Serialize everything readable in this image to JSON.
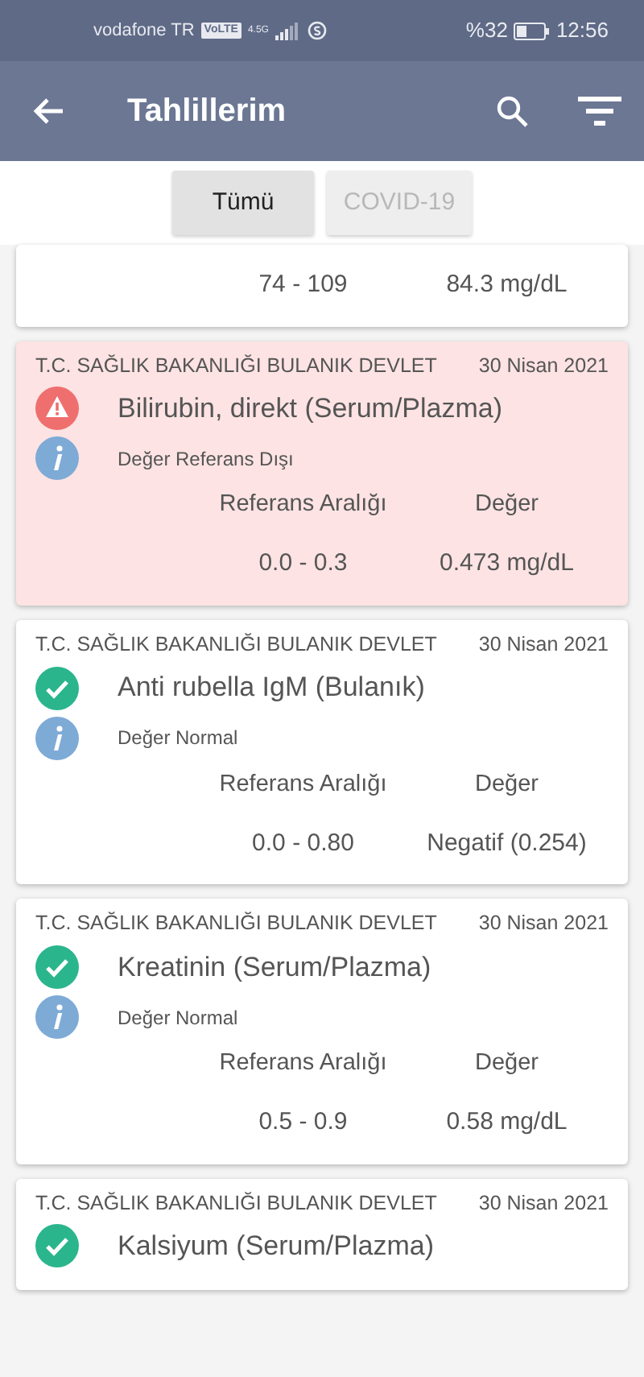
{
  "status_bar": {
    "carrier": "vodafone TR",
    "volte": "VoLTE",
    "network": "4.5G",
    "battery": "%32",
    "time": "12:56"
  },
  "app_bar": {
    "title": "Tahlillerim"
  },
  "tabs": [
    {
      "label": "Tümü",
      "selected": true
    },
    {
      "label": "COVID-19",
      "selected": false
    }
  ],
  "partial_card": {
    "range": "74 - 109",
    "value": "84.3 mg/dL"
  },
  "results": [
    {
      "hospital": "T.C. SAĞLIK BAKANLIĞI BULANIK DEVLET",
      "date": "30 Nisan 2021",
      "test": "Bilirubin, direkt (Serum/Plazma)",
      "kind": "abnormal",
      "status_text": "Değer Referans Dışı",
      "range_heading": "Referans Aralığı",
      "value_heading": "Değer",
      "range": "0.0 - 0.3",
      "value": "0.473 mg/dL"
    },
    {
      "hospital": "T.C. SAĞLIK BAKANLIĞI BULANIK DEVLET",
      "date": "30 Nisan 2021",
      "test": "Anti rubella IgM (Bulanık)",
      "kind": "normal",
      "status_text": "Değer Normal",
      "range_heading": "Referans Aralığı",
      "value_heading": "Değer",
      "range": "0.0 - 0.80",
      "value": "Negatif (0.254)"
    },
    {
      "hospital": "T.C. SAĞLIK BAKANLIĞI BULANIK DEVLET",
      "date": "30 Nisan 2021",
      "test": "Kreatinin (Serum/Plazma)",
      "kind": "normal",
      "status_text": "Değer Normal",
      "range_heading": "Referans Aralığı",
      "value_heading": "Değer",
      "range": "0.5 - 0.9",
      "value": "0.58 mg/dL"
    },
    {
      "hospital": "T.C. SAĞLIK BAKANLIĞI BULANIK DEVLET",
      "date": "30 Nisan 2021",
      "test": "Kalsiyum (Serum/Plazma)",
      "kind": "normal"
    }
  ]
}
